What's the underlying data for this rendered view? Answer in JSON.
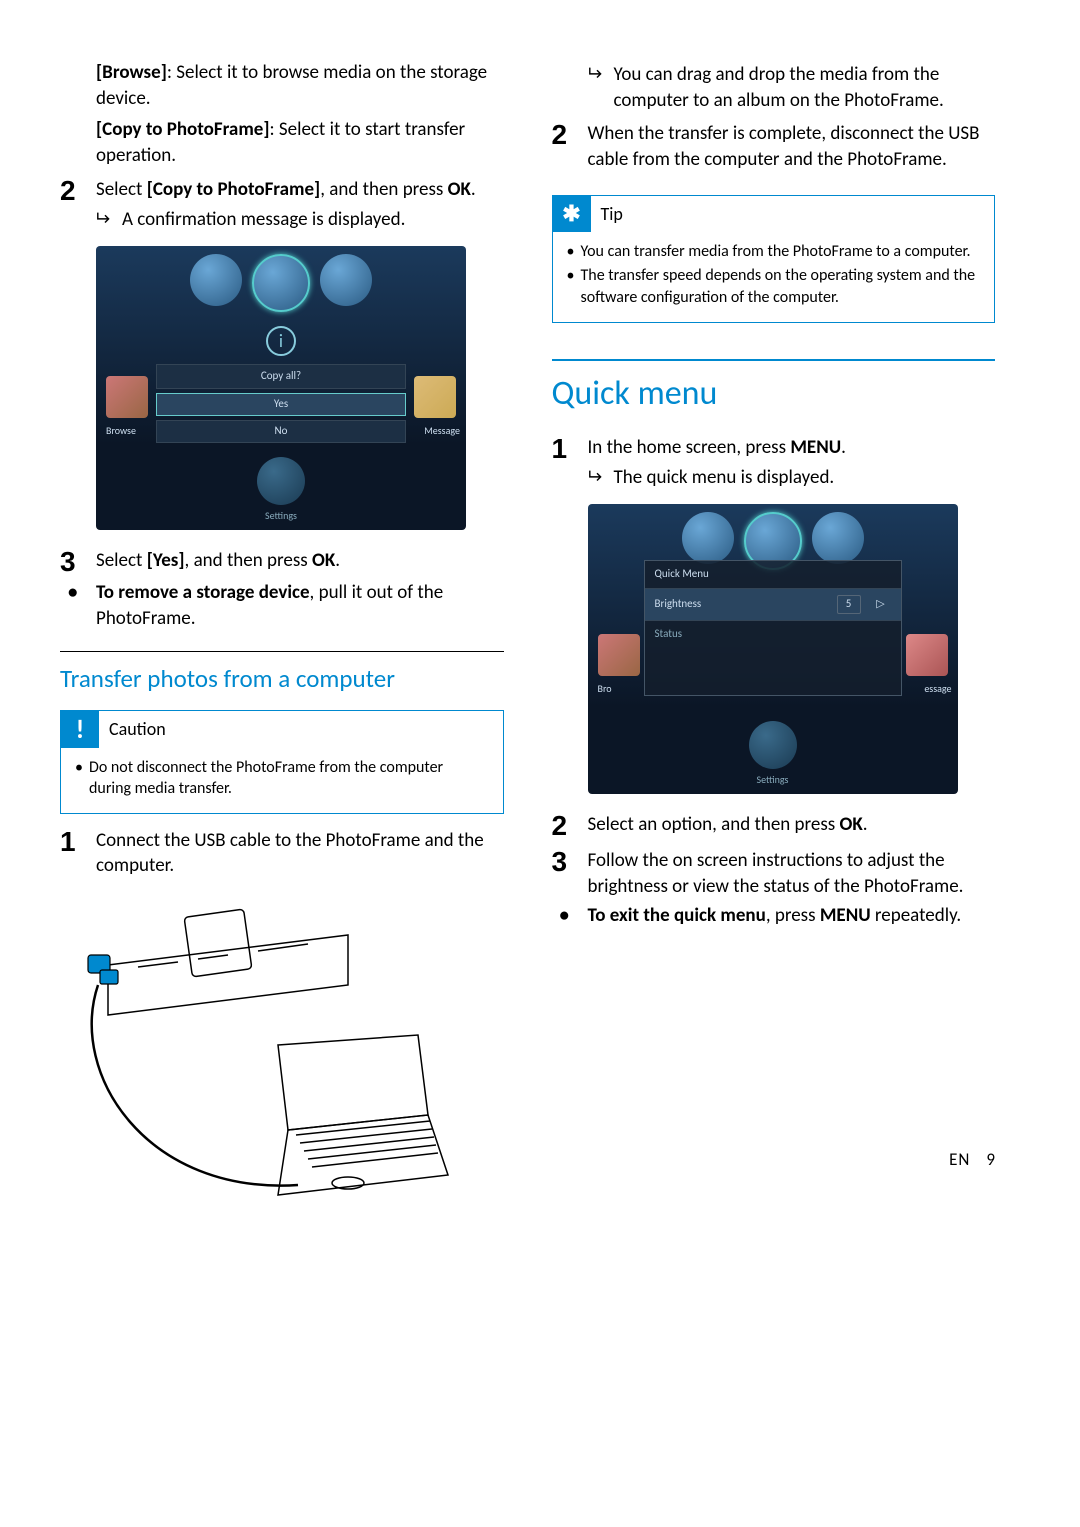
{
  "left": {
    "options": {
      "browse_label": "[Browse]",
      "browse_text": ": Select it to browse media on the storage device.",
      "copy_label": "[Copy to PhotoFrame]",
      "copy_text": ": Select it to start transfer operation."
    },
    "step2": {
      "num": "2",
      "prefix": "Select ",
      "bold": "[Copy to PhotoFrame]",
      "suffix": ", and then press ",
      "ok": "OK",
      "period": "."
    },
    "result2": "A confirmation message is displayed.",
    "copy_dialog": {
      "title": "Copy all?",
      "yes": "Yes",
      "no": "No",
      "browse": "Browse",
      "message": "Message",
      "settings": "Settings"
    },
    "step3": {
      "num": "3",
      "prefix": "Select ",
      "bold": "[Yes]",
      "suffix": ", and then press ",
      "ok": "OK",
      "period": "."
    },
    "remove_bold": "To remove a storage device",
    "remove_text": ", pull it out of the PhotoFrame.",
    "subheading": "Transfer photos from a computer",
    "caution": {
      "label": "Caution",
      "text": "Do not disconnect the PhotoFrame from the computer during media transfer."
    },
    "usb_step1": {
      "num": "1",
      "text": "Connect the USB cable to the PhotoFrame and the computer."
    }
  },
  "right": {
    "dragdrop": "You can drag and drop the media from the computer to an album on the PhotoFrame.",
    "step2": {
      "num": "2",
      "text": "When the transfer is complete, disconnect the USB cable from the computer and the PhotoFrame."
    },
    "tip": {
      "label": "Tip",
      "t1": "You can transfer media from the PhotoFrame to a computer.",
      "t2": "The transfer speed depends on the operating system and the software configuration of the computer."
    },
    "heading": "Quick menu",
    "qm_step1": {
      "num": "1",
      "prefix": "In the home screen, press ",
      "menu": "MENU",
      "period": "."
    },
    "qm_result1": "The quick menu is displayed.",
    "qm_screenshot": {
      "title": "Quick Menu",
      "brightness": "Brightness",
      "value": "5",
      "status": "Status",
      "browse": "Bro",
      "message": "essage",
      "settings": "Settings"
    },
    "qm_step2": {
      "num": "2",
      "prefix": "Select an option, and then press ",
      "ok": "OK",
      "period": "."
    },
    "qm_step3": {
      "num": "3",
      "text": "Follow the on screen instructions to adjust the brightness or view the status of the PhotoFrame."
    },
    "exit_bold": "To exit the quick menu",
    "exit_mid": ", press ",
    "exit_menu": "MENU",
    "exit_suffix": " repeatedly."
  },
  "footer": {
    "lang": "EN",
    "page": "9"
  }
}
